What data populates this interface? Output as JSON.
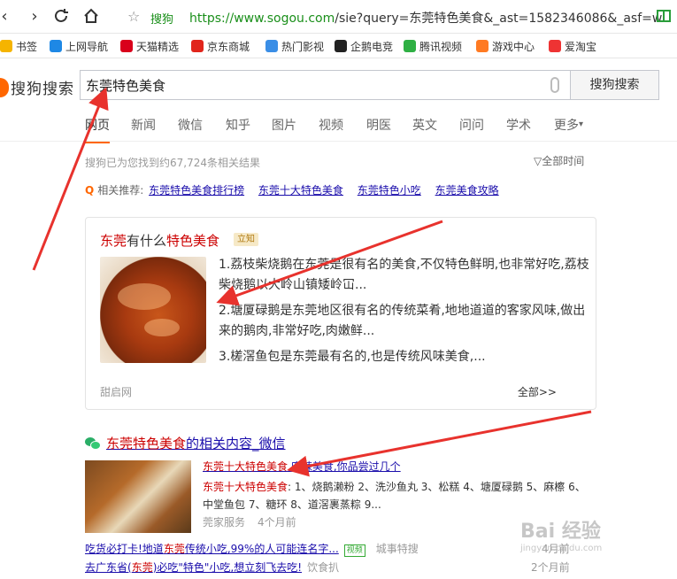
{
  "browser": {
    "site_label": "搜狗",
    "url_prefix": "https://",
    "url_host": "www.sogou.com",
    "url_rest": "/sie?query=东莞特色美食&_ast=1582346086&_asf=w"
  },
  "bookmarks": [
    {
      "label": "书签",
      "icon": "star-icon",
      "color": "#f5b400"
    },
    {
      "label": "上网导航",
      "icon": "e-icon",
      "color": "#1e88e5"
    },
    {
      "label": "天猫精选",
      "icon": "tmall-icon",
      "color": "#d9001b"
    },
    {
      "label": "京东商城",
      "icon": "jd-icon",
      "color": "#e1251b"
    },
    {
      "label": "热门影视",
      "icon": "play-icon",
      "color": "#3a8ee6"
    },
    {
      "label": "企鹅电竞",
      "icon": "penguin-icon",
      "color": "#222"
    },
    {
      "label": "腾讯视频",
      "icon": "tencent-video-icon",
      "color": "#2fb044"
    },
    {
      "label": "游戏中心",
      "icon": "gamepad-icon",
      "color": "#ff7a22"
    },
    {
      "label": "爱淘宝",
      "icon": "taobao-icon",
      "color": "#e33"
    }
  ],
  "search": {
    "logo_text": "搜狗搜索",
    "query": "东莞特色美食",
    "button_label": "搜狗搜索"
  },
  "tabs": [
    "网页",
    "新闻",
    "微信",
    "知乎",
    "图片",
    "视频",
    "明医",
    "英文",
    "问问",
    "学术",
    "更多"
  ],
  "results_info": {
    "count_text": "搜狗已为您找到约67,724条相关结果",
    "time_filter": "全部时间"
  },
  "related": {
    "label": "相关推荐:",
    "links": [
      "东莞特色美食排行榜",
      "东莞十大特色美食",
      "东莞特色小吃",
      "东莞美食攻略"
    ]
  },
  "card": {
    "title_hl": "东莞",
    "title_mid": "有什么",
    "title_hl2": "特色美食",
    "badge": "立知",
    "items": [
      "1.荔枝柴烧鹅在东莞是很有名的美食,不仅特色鲜明,也非常好吃,荔枝柴烧鹅以大岭山镇矮岭冚...",
      "2.塘厦碌鹅是东莞地区很有名的传统菜肴,地地道道的客家风味,做出来的鹅肉,非常好吃,肉嫩鲜...",
      "3.槎滘鱼包是东莞最有名的,也是传统风味美食,..."
    ],
    "source": "甜启网",
    "all_link": "全部>>"
  },
  "wechat": {
    "title_hl": "东莞特色美食",
    "title_rest": "的相关内容_微信",
    "sub_hl": "东莞十大特色美食",
    "sub_rest": ",麻辣美食,你品尝过几个",
    "desc_hl": "东莞十大特色美食",
    "desc_rest": ": 1、烧鹅濑粉 2、洗沙鱼丸 3、松糕 4、塘厦碌鹅 5、麻檫 6、中堂鱼包 7、糖环 8、道滘裹蒸粽 9...",
    "meta_source": "莞家服务",
    "meta_time": "4个月前"
  },
  "sub_results": [
    {
      "pre": "吃货必打卡!地道",
      "hl": "东莞",
      "post": "传统小吃,99%的人可能连名字...",
      "tag": "视频",
      "source": "城事特搜",
      "time": "4月前"
    },
    {
      "pre": "去广东省(",
      "hl": "东莞",
      "post": ")必吃\"特色\"小吃,想立刻飞去吃!",
      "tag": "",
      "source": "饮食扒",
      "time": "2个月前"
    }
  ],
  "watermark": {
    "text": "Bai 经验",
    "sub": "jingyan.baidu.com"
  }
}
